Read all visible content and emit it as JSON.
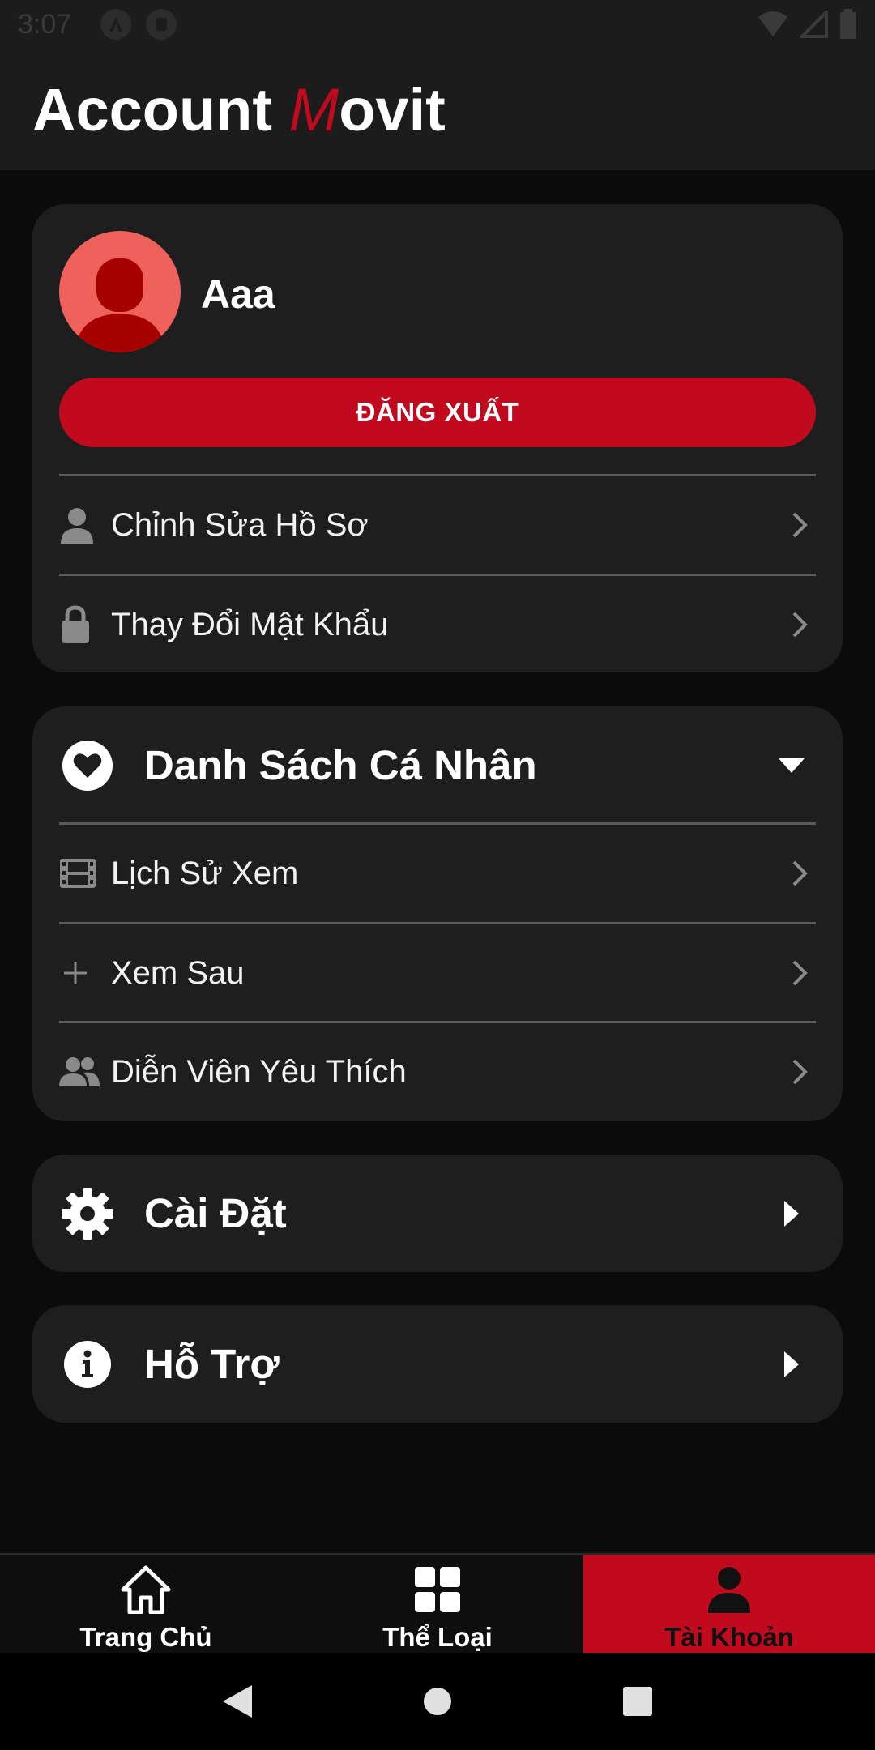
{
  "status_bar": {
    "time": "3:07"
  },
  "header": {
    "title_prefix": "Account ",
    "brand_m": "M",
    "brand_rest": "ovit"
  },
  "profile": {
    "username": "Aaa",
    "logout_label": "ĐĂNG XUẤT",
    "items": [
      {
        "label": "Chỉnh Sửa Hồ Sơ",
        "icon": "person-icon"
      },
      {
        "label": "Thay Đổi Mật Khẩu",
        "icon": "lock-icon"
      }
    ]
  },
  "personal_list": {
    "title": "Danh Sách Cá Nhân",
    "icon": "heart-icon",
    "expanded": true,
    "items": [
      {
        "label": "Lịch Sử Xem",
        "icon": "film-icon"
      },
      {
        "label": "Xem Sau",
        "icon": "plus-icon"
      },
      {
        "label": "Diễn Viên Yêu Thích",
        "icon": "people-icon"
      }
    ]
  },
  "settings": {
    "title": "Cài Đặt",
    "icon": "gear-icon"
  },
  "support": {
    "title": "Hỗ Trợ",
    "icon": "info-icon"
  },
  "bottom_nav": {
    "items": [
      {
        "label": "Trang Chủ",
        "icon": "home-icon",
        "active": false
      },
      {
        "label": "Thể Loại",
        "icon": "grid-icon",
        "active": false
      },
      {
        "label": "Tài Khoản",
        "icon": "account-icon",
        "active": true
      }
    ]
  },
  "colors": {
    "accent": "#c20a1e",
    "avatar_bg": "#ef625c",
    "card": "#1e1e1e",
    "background": "#0b0b0b"
  }
}
